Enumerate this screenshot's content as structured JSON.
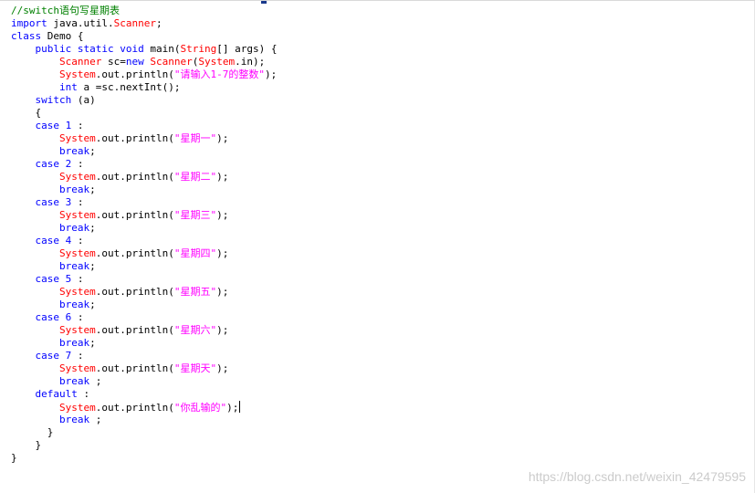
{
  "colors": {
    "comment": "#008000",
    "keyword": "#0000ff",
    "class": "#ff0000",
    "string": "#ff00ff",
    "plain": "#000000"
  },
  "caret_line_index": 31,
  "code_lines": [
    [
      [
        "comment",
        "//switch语句写星期表"
      ]
    ],
    [
      [
        "keyword",
        "import"
      ],
      [
        "plain",
        " java.util."
      ],
      [
        "class",
        "Scanner"
      ],
      [
        "plain",
        ";"
      ]
    ],
    [
      [
        "keyword",
        "class"
      ],
      [
        "plain",
        " Demo {"
      ]
    ],
    [
      [
        "plain",
        "    "
      ],
      [
        "keyword",
        "public static void"
      ],
      [
        "plain",
        " main("
      ],
      [
        "class",
        "String"
      ],
      [
        "plain",
        "[] args) {"
      ]
    ],
    [
      [
        "plain",
        "        "
      ],
      [
        "class",
        "Scanner"
      ],
      [
        "plain",
        " sc="
      ],
      [
        "keyword",
        "new"
      ],
      [
        "plain",
        " "
      ],
      [
        "class",
        "Scanner"
      ],
      [
        "plain",
        "("
      ],
      [
        "class",
        "System"
      ],
      [
        "plain",
        ".in);"
      ]
    ],
    [
      [
        "plain",
        "        "
      ],
      [
        "class",
        "System"
      ],
      [
        "plain",
        ".out.println("
      ],
      [
        "string",
        "\"请输入1-7的整数\""
      ],
      [
        "plain",
        ");"
      ]
    ],
    [
      [
        "plain",
        "        "
      ],
      [
        "keyword",
        "int"
      ],
      [
        "plain",
        " a =sc.nextInt();"
      ]
    ],
    [
      [
        "plain",
        "    "
      ],
      [
        "keyword",
        "switch"
      ],
      [
        "plain",
        " (a)"
      ]
    ],
    [
      [
        "plain",
        "    {"
      ]
    ],
    [
      [
        "plain",
        "    "
      ],
      [
        "keyword",
        "case"
      ],
      [
        "plain",
        " "
      ],
      [
        "keyword",
        "1"
      ],
      [
        "plain",
        " :"
      ]
    ],
    [
      [
        "plain",
        "        "
      ],
      [
        "class",
        "System"
      ],
      [
        "plain",
        ".out.println("
      ],
      [
        "string",
        "\"星期一\""
      ],
      [
        "plain",
        ");"
      ]
    ],
    [
      [
        "plain",
        "        "
      ],
      [
        "keyword",
        "break"
      ],
      [
        "plain",
        ";"
      ]
    ],
    [
      [
        "plain",
        "    "
      ],
      [
        "keyword",
        "case"
      ],
      [
        "plain",
        " "
      ],
      [
        "keyword",
        "2"
      ],
      [
        "plain",
        " :"
      ]
    ],
    [
      [
        "plain",
        "        "
      ],
      [
        "class",
        "System"
      ],
      [
        "plain",
        ".out.println("
      ],
      [
        "string",
        "\"星期二\""
      ],
      [
        "plain",
        ");"
      ]
    ],
    [
      [
        "plain",
        "        "
      ],
      [
        "keyword",
        "break"
      ],
      [
        "plain",
        ";"
      ]
    ],
    [
      [
        "plain",
        "    "
      ],
      [
        "keyword",
        "case"
      ],
      [
        "plain",
        " "
      ],
      [
        "keyword",
        "3"
      ],
      [
        "plain",
        " :"
      ]
    ],
    [
      [
        "plain",
        "        "
      ],
      [
        "class",
        "System"
      ],
      [
        "plain",
        ".out.println("
      ],
      [
        "string",
        "\"星期三\""
      ],
      [
        "plain",
        ");"
      ]
    ],
    [
      [
        "plain",
        "        "
      ],
      [
        "keyword",
        "break"
      ],
      [
        "plain",
        ";"
      ]
    ],
    [
      [
        "plain",
        "    "
      ],
      [
        "keyword",
        "case"
      ],
      [
        "plain",
        " "
      ],
      [
        "keyword",
        "4"
      ],
      [
        "plain",
        " :"
      ]
    ],
    [
      [
        "plain",
        "        "
      ],
      [
        "class",
        "System"
      ],
      [
        "plain",
        ".out.println("
      ],
      [
        "string",
        "\"星期四\""
      ],
      [
        "plain",
        ");"
      ]
    ],
    [
      [
        "plain",
        "        "
      ],
      [
        "keyword",
        "break"
      ],
      [
        "plain",
        ";"
      ]
    ],
    [
      [
        "plain",
        "    "
      ],
      [
        "keyword",
        "case"
      ],
      [
        "plain",
        " "
      ],
      [
        "keyword",
        "5"
      ],
      [
        "plain",
        " :"
      ]
    ],
    [
      [
        "plain",
        "        "
      ],
      [
        "class",
        "System"
      ],
      [
        "plain",
        ".out.println("
      ],
      [
        "string",
        "\"星期五\""
      ],
      [
        "plain",
        ");"
      ]
    ],
    [
      [
        "plain",
        "        "
      ],
      [
        "keyword",
        "break"
      ],
      [
        "plain",
        ";"
      ]
    ],
    [
      [
        "plain",
        "    "
      ],
      [
        "keyword",
        "case"
      ],
      [
        "plain",
        " "
      ],
      [
        "keyword",
        "6"
      ],
      [
        "plain",
        " :"
      ]
    ],
    [
      [
        "plain",
        "        "
      ],
      [
        "class",
        "System"
      ],
      [
        "plain",
        ".out.println("
      ],
      [
        "string",
        "\"星期六\""
      ],
      [
        "plain",
        ");"
      ]
    ],
    [
      [
        "plain",
        "        "
      ],
      [
        "keyword",
        "break"
      ],
      [
        "plain",
        ";"
      ]
    ],
    [
      [
        "plain",
        "    "
      ],
      [
        "keyword",
        "case"
      ],
      [
        "plain",
        " "
      ],
      [
        "keyword",
        "7"
      ],
      [
        "plain",
        " :"
      ]
    ],
    [
      [
        "plain",
        "        "
      ],
      [
        "class",
        "System"
      ],
      [
        "plain",
        ".out.println("
      ],
      [
        "string",
        "\"星期天\""
      ],
      [
        "plain",
        ");"
      ]
    ],
    [
      [
        "plain",
        "        "
      ],
      [
        "keyword",
        "break"
      ],
      [
        "plain",
        " ;"
      ]
    ],
    [
      [
        "plain",
        "    "
      ],
      [
        "keyword",
        "default"
      ],
      [
        "plain",
        " :"
      ]
    ],
    [
      [
        "plain",
        "        "
      ],
      [
        "class",
        "System"
      ],
      [
        "plain",
        ".out.println("
      ],
      [
        "string",
        "\"你乱输的\""
      ],
      [
        "plain",
        ");"
      ]
    ],
    [
      [
        "plain",
        "        "
      ],
      [
        "keyword",
        "break"
      ],
      [
        "plain",
        " ;"
      ]
    ],
    [
      [
        "plain",
        "      }"
      ]
    ],
    [
      [
        "plain",
        "    }"
      ]
    ],
    [
      [
        "plain",
        "}"
      ]
    ]
  ],
  "watermark": "https://blog.csdn.net/weixin_42479595"
}
